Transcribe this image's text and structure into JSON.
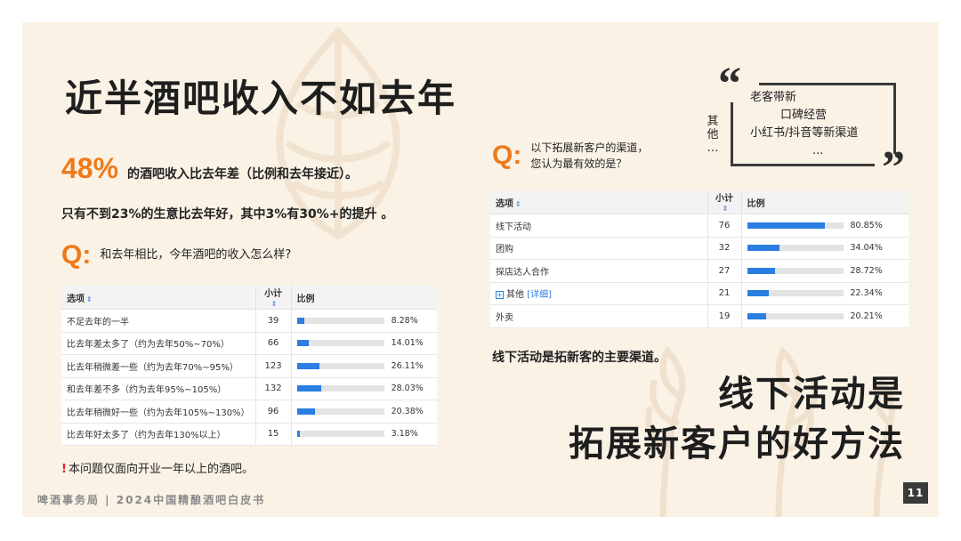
{
  "title": "近半酒吧收入不如去年",
  "stat": {
    "value": "48%",
    "text": "的酒吧收入比去年差（比例和去年接近）。"
  },
  "subline": "只有不到23%的生意比去年好，其中3%有30%+的提升 。",
  "q1": {
    "mark": "Q:",
    "text": "和去年相比，今年酒吧的收入怎么样?"
  },
  "table_headers": {
    "option": "选项",
    "count": "小计",
    "ratio": "比例"
  },
  "table1": [
    {
      "label": "不足去年的一半",
      "count": "39",
      "pct": "8.28%",
      "value": 8.28
    },
    {
      "label": "比去年差太多了（约为去年50%~70%）",
      "count": "66",
      "pct": "14.01%",
      "value": 14.01
    },
    {
      "label": "比去年稍微差一些（约为去年70%~95%）",
      "count": "123",
      "pct": "26.11%",
      "value": 26.11
    },
    {
      "label": "和去年差不多（约为去年95%~105%）",
      "count": "132",
      "pct": "28.03%",
      "value": 28.03
    },
    {
      "label": "比去年稍微好一些（约为去年105%~130%）",
      "count": "96",
      "pct": "20.38%",
      "value": 20.38
    },
    {
      "label": "比去年好太多了（约为去年130%以上）",
      "count": "15",
      "pct": "3.18%",
      "value": 3.18
    }
  ],
  "note": "本问题仅面向开业一年以上的酒吧。",
  "q2": {
    "mark": "Q:",
    "line1": "以下拓展新客户的渠道，",
    "line2": "您认为最有效的是？"
  },
  "table2": [
    {
      "label": "线下活动",
      "count": "76",
      "pct": "80.85%",
      "value": 80.85
    },
    {
      "label": "团购",
      "count": "32",
      "pct": "34.04%",
      "value": 34.04
    },
    {
      "label": "探店达人合作",
      "count": "27",
      "pct": "28.72%",
      "value": 28.72
    },
    {
      "label": "其他",
      "detail": "[详细]",
      "count": "21",
      "pct": "22.34%",
      "value": 22.34
    },
    {
      "label": "外卖",
      "count": "19",
      "pct": "20.21%",
      "value": 20.21
    }
  ],
  "quote": {
    "side_label_1": "其",
    "side_label_2": "他",
    "side_label_3": "…",
    "lines": [
      "老客带新",
      "口碑经营",
      "小红书/抖音等新渠道",
      "..."
    ]
  },
  "conclusion": "线下活动是拓新客的主要渠道。",
  "headline": {
    "line1": "线下活动是",
    "line2": "拓展新客户的好方法"
  },
  "footer": "啤酒事务局 | 2024中国精酿酒吧白皮书",
  "page_number": "11",
  "colors": {
    "accent": "#ef7a1b",
    "bar": "#2a7de1",
    "background": "#fbf2e6"
  }
}
